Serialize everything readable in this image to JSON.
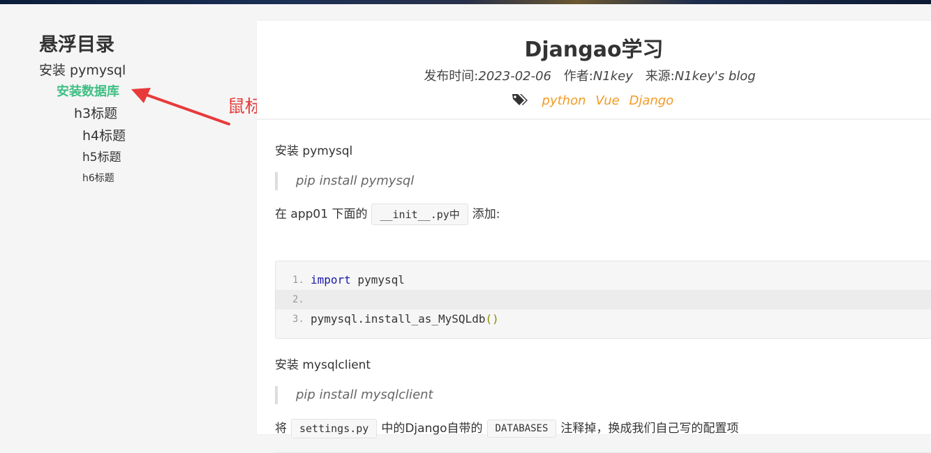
{
  "toc": {
    "title": "悬浮目录",
    "items": [
      {
        "label": "安装 pymysql",
        "level": "h2"
      },
      {
        "label": "安装数据库",
        "level": "h2",
        "state": "hover"
      },
      {
        "label": "h3标题",
        "level": "h3"
      },
      {
        "label": "h4标题",
        "level": "h4"
      },
      {
        "label": "h5标题",
        "level": "h5"
      },
      {
        "label": "h6标题",
        "level": "h6"
      }
    ],
    "active_color": "#3fbf84"
  },
  "annotation": {
    "text": "鼠标放上",
    "color": "#e83a3a"
  },
  "post": {
    "title": "Djangao学习",
    "meta": {
      "date_label": "发布时间:",
      "date": "2023-02-06",
      "author_label": "作者:",
      "author": "N1key",
      "source_label": "来源:",
      "source": "N1key's blog"
    },
    "tags_icon": "tags-icon",
    "tags": [
      "python",
      "Vue",
      "Django"
    ],
    "tag_color": "#f59a23"
  },
  "body": {
    "p1": "安装 pymysql",
    "quote1": "pip install pymysql",
    "p2_pre": "在 app01 下面的",
    "p2_code": "__init__.py中",
    "p2_post": "添加:",
    "code": {
      "lines": [
        {
          "num": "1.",
          "kw": "import",
          "rest": " pymysql"
        },
        {
          "num": "2.",
          "kw": "",
          "rest": ""
        },
        {
          "num": "3.",
          "kw": "",
          "rest": "pymysql.install_as_MySQLdb",
          "parens": "()"
        }
      ]
    },
    "p3": "安装 mysqlclient",
    "quote2": "pip install mysqlclient",
    "p4_pre": "将",
    "p4_code1": "settings.py",
    "p4_mid": "中的Django自带的",
    "p4_code2": "DATABASES",
    "p4_post": "注释掉，换成我们自己写的配置项"
  }
}
